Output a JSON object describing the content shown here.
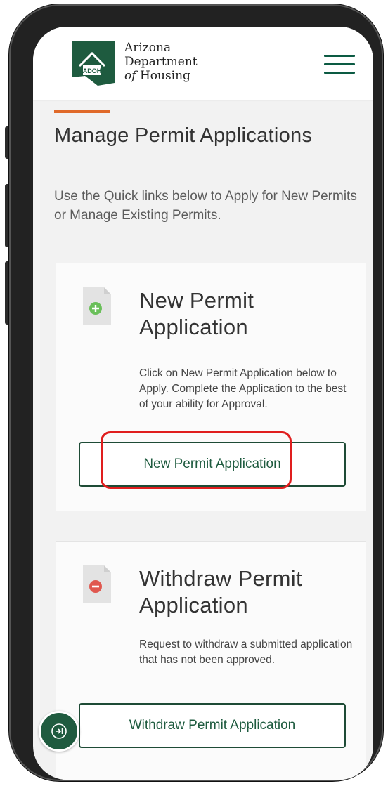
{
  "brand": {
    "logo_abbrev": "ADOH",
    "name_line1": "Arizona",
    "name_line2": "Department",
    "name_line3_prefix": "of",
    "name_line3_suffix": "Housing"
  },
  "header": {
    "menu_icon": "hamburger-menu-icon"
  },
  "page": {
    "title": "Manage Permit Applications",
    "subtitle": "Use the Quick links below to Apply for New Permits or Manage Existing Permits."
  },
  "cards": [
    {
      "icon": "document-add-icon",
      "title": "New Permit Application",
      "description": "Click on New Permit Application below to Apply. Complete the Application to the best of your ability for Approval.",
      "button_label": "New Permit Application"
    },
    {
      "icon": "document-remove-icon",
      "title": "Withdraw Permit Application",
      "description": "Request to withdraw a submitted application that has not been approved.",
      "button_label": "Withdraw Permit Application"
    }
  ],
  "floating_button": {
    "icon": "arrow-to-right-icon"
  },
  "colors": {
    "brand_green": "#1e5b3f",
    "accent_orange": "#e06a2a",
    "highlight_red": "#e01e1e",
    "add_green": "#6abf5a",
    "remove_red": "#e0584f"
  }
}
